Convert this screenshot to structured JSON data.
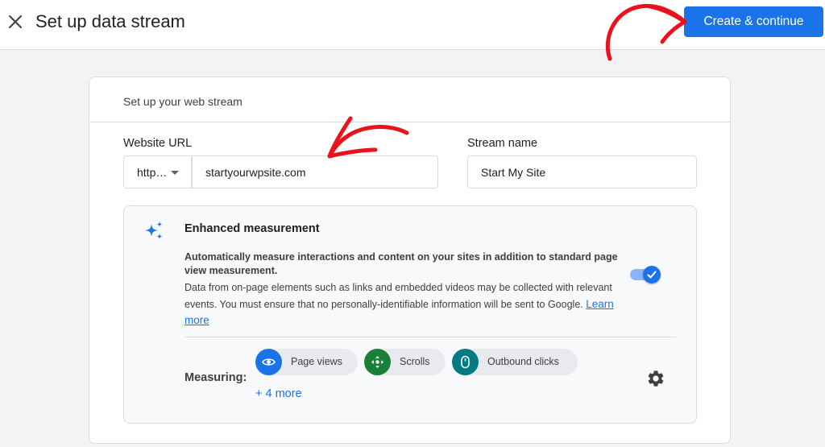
{
  "header": {
    "title": "Set up data stream",
    "create_button": "Create & continue"
  },
  "card": {
    "title": "Set up your web stream",
    "website_url": {
      "label": "Website URL",
      "protocol": "http…",
      "value": "startyourwpsite.com"
    },
    "stream_name": {
      "label": "Stream name",
      "value": "Start My Site"
    },
    "enhanced_measurement": {
      "title": "Enhanced measurement",
      "description_bold": "Automatically measure interactions and content on your sites in addition to standard page view measurement.",
      "description": "Data from on-page elements such as links and embedded videos may be collected with relevant events. You must ensure that no personally-identifiable information will be sent to Google.",
      "learn_more": "Learn more",
      "toggle_on": true,
      "measuring_label": "Measuring:",
      "chips": [
        {
          "label": "Page views",
          "icon": "eye-icon",
          "color": "#1a73e8"
        },
        {
          "label": "Scrolls",
          "icon": "scroll-target-icon",
          "color": "#188038"
        },
        {
          "label": "Outbound clicks",
          "icon": "mouse-icon",
          "color": "#007b83"
        }
      ],
      "more_link": "+ 4 more"
    }
  },
  "colors": {
    "primary": "#1a73e8",
    "annotation": "#e8131c"
  }
}
